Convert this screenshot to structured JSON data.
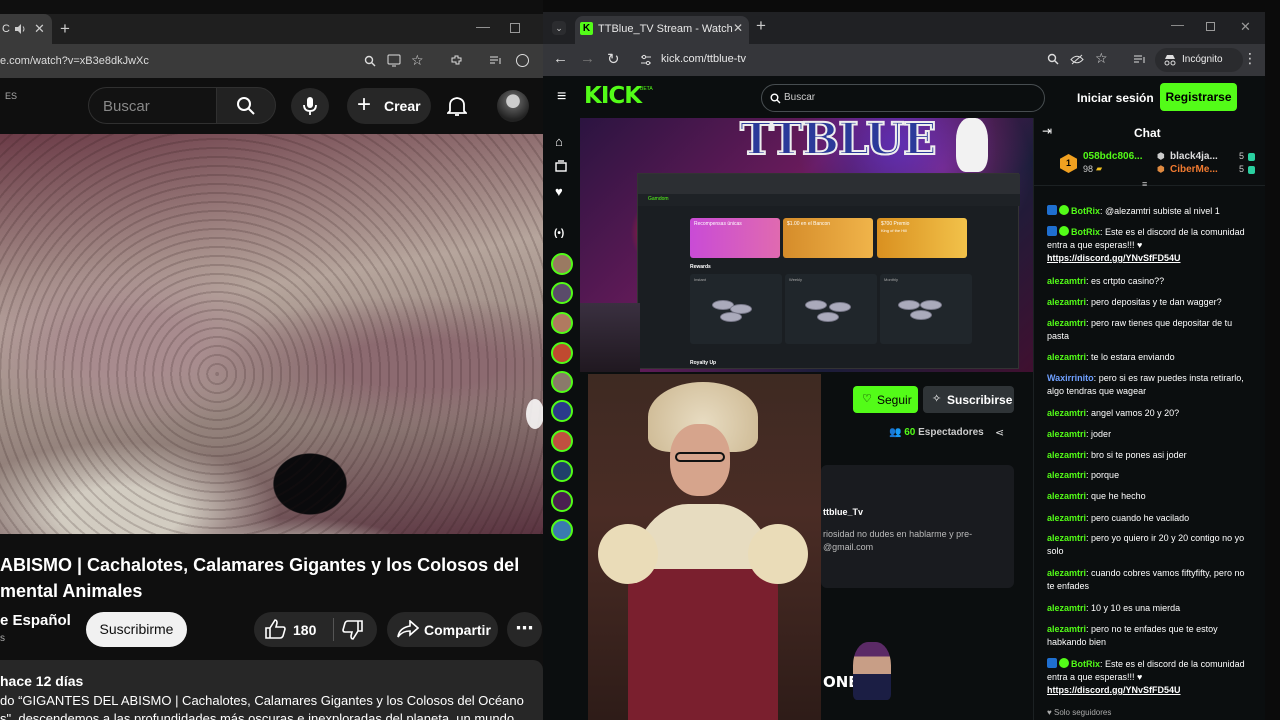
{
  "youtube": {
    "tab_title": "C",
    "url": "e.com/watch?v=xB3e8dkJwXc",
    "lang_badge": "ES",
    "search_placeholder": "Buscar",
    "create_label": "Crear",
    "video_title_line1": "ABISMO | Cachalotes, Calamares Gigantes y los Colosos del",
    "video_title_line2": "mental Animales",
    "channel_name": "e Español",
    "channel_sub": "s",
    "subscribe_label": "Suscribirme",
    "likes": "180",
    "share_label": "Compartir",
    "upload_age": "hace 12 días",
    "desc_line1": "do “GIGANTES DEL ABISMO | Cachalotes, Calamares Gigantes y los Colosos del Océano",
    "desc_line2": "s\", descendemos a las profundidades más oscuras e inexploradas del planeta, un mundo"
  },
  "kick": {
    "tab_title": "TTBlue_TV Stream - Watch",
    "url": "kick.com/ttblue-tv",
    "incognito_label": "Incógnito",
    "logo": "KICK",
    "logo_beta": "BETA",
    "search_placeholder": "Buscar",
    "login_label": "Iniciar sesión",
    "signup_label": "Registrarse",
    "stream_banner": "TTBLUE",
    "inner_site": {
      "card1": "Recompensas únicas",
      "card2": "$1.00 en el Bancon",
      "card3": "$700 Premio",
      "card3_sub": "King of the Hill",
      "section_title": "Rewards",
      "box_labels": [
        "Instant",
        "Weekly",
        "Monthly"
      ],
      "footer": "Royalty Up",
      "brand": "Gamdom"
    },
    "follow_label": "Seguir",
    "subscribe_label": "Suscribirse",
    "viewers_count": "60",
    "viewers_label": "Espectadores",
    "about_name": "ttblue_Tv",
    "about_line1": "riosidad no dudes en hablarme y pre-",
    "about_line2": "@gmail.com",
    "overlay_text": "ONES",
    "chat": {
      "title": "Chat",
      "leaders": [
        {
          "name": "058bdc806...",
          "score": "98",
          "rank": "1"
        },
        {
          "name": "black4ja...",
          "score": "5"
        },
        {
          "name": "CiberMe...",
          "score": "5"
        }
      ],
      "messages": [
        {
          "user": "BotRix",
          "text": "@alezamtri subiste al nivel 1",
          "bot": true
        },
        {
          "user": "BotRix",
          "text": "Este es el discord de la comunidad entra a que esperas!!! ♥",
          "link": "https://discord.gg/YNvSfFD54U",
          "bot": true
        },
        {
          "user": "alezamtri",
          "text": "es crtpto casino??"
        },
        {
          "user": "alezamtri",
          "text": "pero depositas y te dan wagger?"
        },
        {
          "user": "alezamtri",
          "text": "pero raw tienes que depositar de tu pasta"
        },
        {
          "user": "alezamtri",
          "text": "te lo estara enviando"
        },
        {
          "user": "Waxirrinito",
          "text": "pero si es raw puedes insta retirarlo, algo tendras que wagear"
        },
        {
          "user": "alezamtri",
          "text": "angel vamos 20 y 20?"
        },
        {
          "user": "alezamtri",
          "text": "joder"
        },
        {
          "user": "alezamtri",
          "text": "bro si te pones asi joder"
        },
        {
          "user": "alezamtri",
          "text": "porque"
        },
        {
          "user": "alezamtri",
          "text": "que he hecho"
        },
        {
          "user": "alezamtri",
          "text": "pero cuando he vacilado"
        },
        {
          "user": "alezamtri",
          "text": "pero yo quiero ir 20 y 20 contigo no yo solo"
        },
        {
          "user": "alezamtri",
          "text": "cuando cobres vamos fiftyfifty, pero no te enfades"
        },
        {
          "user": "alezamtri",
          "text": "10 y 10 es una mierda"
        },
        {
          "user": "alezamtri",
          "text": "pero no te enfades que te estoy habkando bien"
        },
        {
          "user": "BotRix",
          "text": "Este es el discord de la comunidad entra a que esperas!!! ♥",
          "link": "https://discord.gg/YNvSfFD54U",
          "bot": true
        }
      ],
      "footer": "Solo seguidores"
    }
  },
  "colors": {
    "kick_green": "#53fc18",
    "youtube_bg": "#0f0f0f",
    "kick_bg": "#0b0e0f"
  }
}
